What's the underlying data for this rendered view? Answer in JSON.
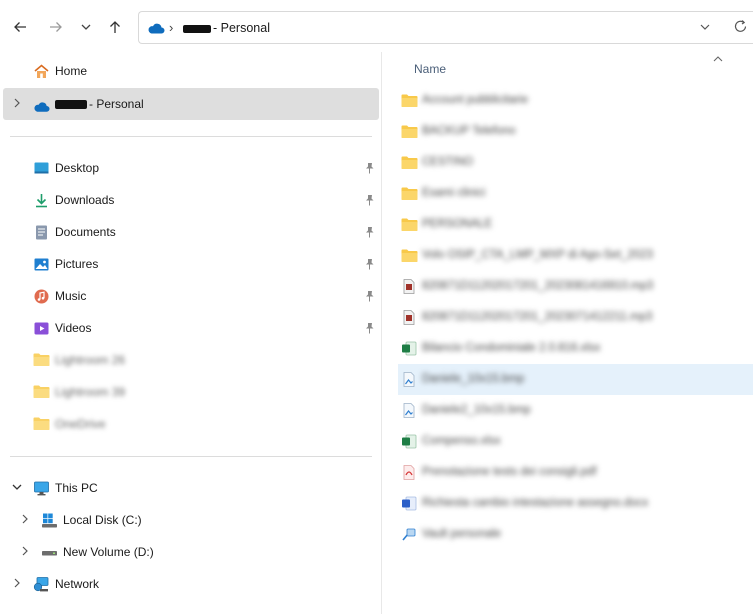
{
  "address": {
    "account_suffix": "- Personal",
    "separator": "›"
  },
  "sidebar": {
    "home": "Home",
    "onedrive_suffix": "- Personal",
    "quick_access": [
      {
        "label": "Desktop",
        "icon": "desktop-icon",
        "pinned": true
      },
      {
        "label": "Downloads",
        "icon": "download-icon",
        "pinned": true
      },
      {
        "label": "Documents",
        "icon": "documents-icon",
        "pinned": true
      },
      {
        "label": "Pictures",
        "icon": "pictures-icon",
        "pinned": true
      },
      {
        "label": "Music",
        "icon": "music-icon",
        "pinned": true
      },
      {
        "label": "Videos",
        "icon": "videos-icon",
        "pinned": true
      },
      {
        "label": "Lightroom 26",
        "icon": "folder-icon",
        "pinned": false
      },
      {
        "label": "Lightroom 39",
        "icon": "folder-icon",
        "pinned": false
      },
      {
        "label": "OneDrive",
        "icon": "folder-icon",
        "pinned": false
      }
    ],
    "this_pc": "This PC",
    "local_disk": "Local Disk (C:)",
    "new_volume": "New Volume (D:)",
    "network": "Network"
  },
  "list": {
    "column_name": "Name",
    "items": [
      {
        "name": "Account pubblicitarie",
        "type": "folder"
      },
      {
        "name": "BACKUP Telefono",
        "type": "folder"
      },
      {
        "name": "CESTINO",
        "type": "folder"
      },
      {
        "name": "Esami clinici",
        "type": "folder"
      },
      {
        "name": "PERSONALE",
        "type": "folder"
      },
      {
        "name": "Volo OSIP_CTA_LMP_MXP di Ago-Set_2023",
        "type": "folder"
      },
      {
        "name": "820871D11202017201_2023081416910.mp3",
        "type": "audio"
      },
      {
        "name": "820871D11202017201_2023071412211.mp3",
        "type": "audio"
      },
      {
        "name": "Bilancio Condominiale 2.0.816.xlsx",
        "type": "excel"
      },
      {
        "name": "Daniele_10x15.bmp",
        "type": "image"
      },
      {
        "name": "Daniele2_10x15.bmp",
        "type": "image"
      },
      {
        "name": "Compenso.xlsx",
        "type": "excel"
      },
      {
        "name": "Prenotazione tests dei consigli.pdf",
        "type": "pdf"
      },
      {
        "name": "Richiesta cambio intestazione assegno.docx",
        "type": "word"
      },
      {
        "name": "Vault personale",
        "type": "vault"
      }
    ]
  },
  "colors": {
    "selected_bg": "#dedede",
    "highlight_row": "#e5f1fb",
    "folder": "#f8c94a",
    "onedrive": "#0f6cbd"
  }
}
